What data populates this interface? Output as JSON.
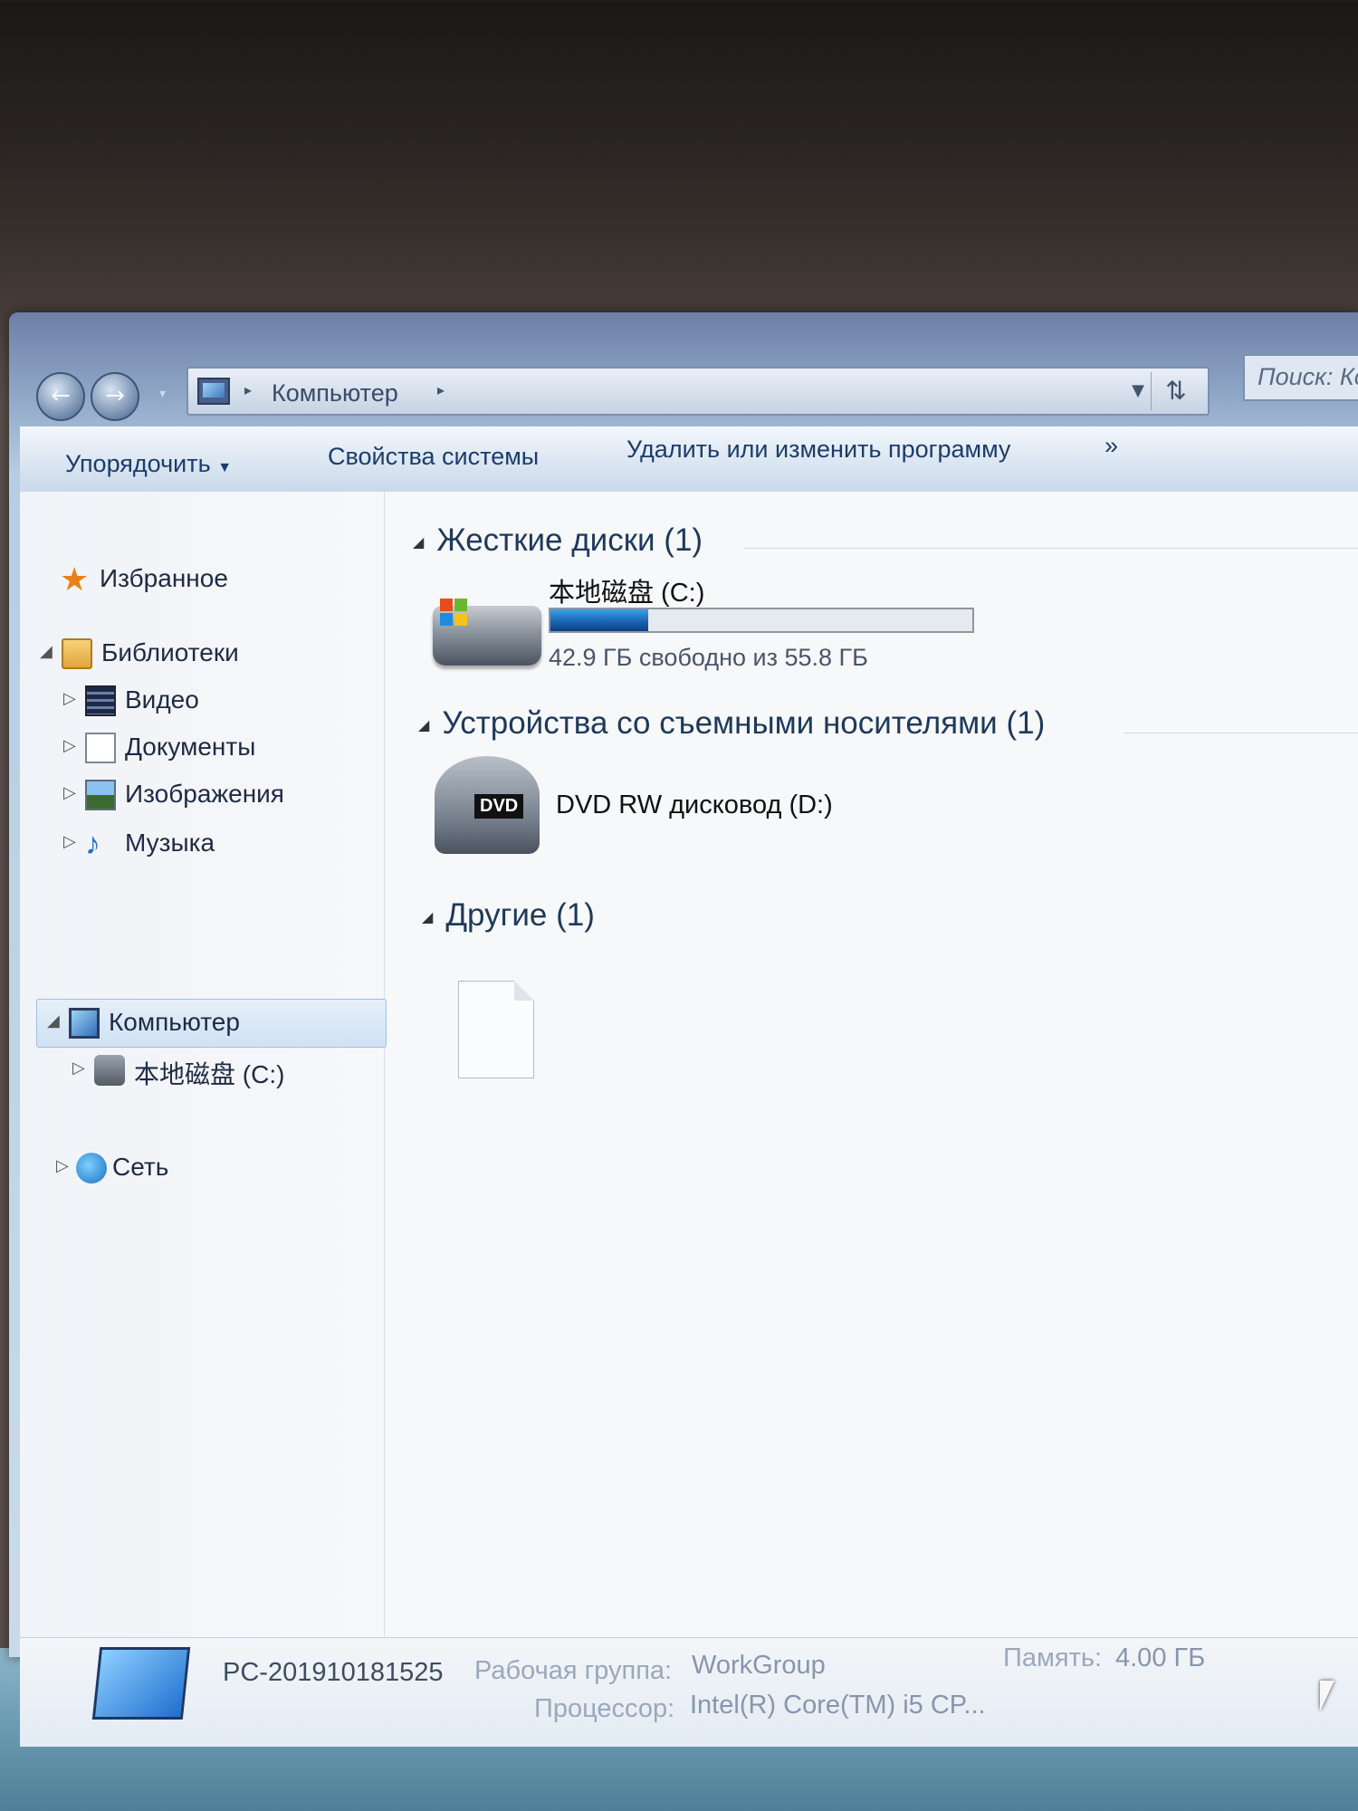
{
  "address_bar": {
    "breadcrumb": "Компьютер",
    "search_placeholder": "Поиск: Ко"
  },
  "toolbar": {
    "organize": "Упорядочить",
    "system_properties": "Свойства системы",
    "uninstall": "Удалить или изменить программу",
    "more": "»"
  },
  "nav_pane": {
    "favorites": "Избранное",
    "libraries": "Библиотеки",
    "videos": "Видео",
    "documents": "Документы",
    "images": "Изображения",
    "music": "Музыка",
    "computer": "Компьютер",
    "local_disk": "本地磁盘 (C:)",
    "network": "Сеть"
  },
  "groups": {
    "hard_disks": {
      "header": "Жесткие диски (1)",
      "drive_name": "本地磁盘 (C:)",
      "free_text": "42.9 ГБ свободно из 55.8 ГБ",
      "used_fraction": 0.231
    },
    "removable": {
      "header": "Устройства со съемными носителями (1)",
      "drive_name": "DVD RW дисковод (D:)",
      "icon_label": "DVD"
    },
    "other": {
      "header": "Другие (1)"
    }
  },
  "details": {
    "pc_name": "PC-201910181525",
    "workgroup_label": "Рабочая группа:",
    "workgroup_value": "WorkGroup",
    "memory_label": "Память:",
    "memory_value": "4.00 ГБ",
    "cpu_label": "Процессор:",
    "cpu_value": "Intel(R) Core(TM) i5 CP..."
  }
}
